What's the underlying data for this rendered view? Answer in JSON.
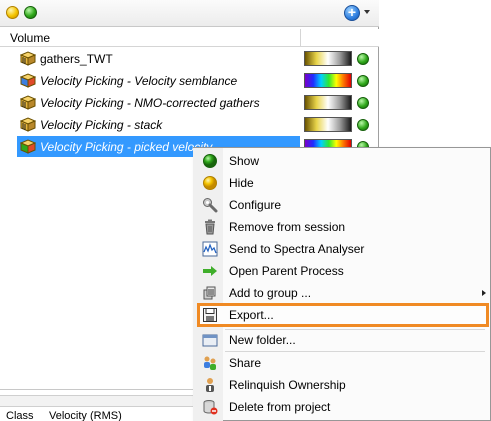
{
  "toolbar": {
    "status_dots": [
      "yellow",
      "green"
    ],
    "add_icon": "plus-circle-icon",
    "add_label": "+"
  },
  "columns": {
    "volume": "Volume"
  },
  "rows": [
    {
      "label": "gathers_TWT",
      "italic": false,
      "colorbar": "grayscale",
      "status": "green"
    },
    {
      "label": "Velocity Picking - Velocity semblance",
      "italic": true,
      "colorbar": "rainbow",
      "status": "green"
    },
    {
      "label": "Velocity Picking - NMO-corrected gathers",
      "italic": true,
      "colorbar": "grayscale",
      "status": "green"
    },
    {
      "label": "Velocity Picking - stack",
      "italic": true,
      "colorbar": "grayscale",
      "status": "green"
    },
    {
      "label": "Velocity Picking - picked velocity",
      "italic": true,
      "colorbar": "rainbow",
      "status": "green",
      "selected": true
    }
  ],
  "properties": {
    "class_label": "Class",
    "class_value": "Velocity (RMS)"
  },
  "menu": {
    "items": [
      {
        "label": "Show",
        "icon": "green-dot-icon"
      },
      {
        "label": "Hide",
        "icon": "yellow-dot-icon"
      },
      {
        "label": "Configure",
        "icon": "wrench-icon"
      },
      {
        "label": "Remove from session",
        "icon": "trash-icon"
      },
      {
        "label": "Send to Spectra Analyser",
        "icon": "spectrum-icon"
      },
      {
        "label": "Open Parent Process",
        "icon": "green-arrow-icon"
      },
      {
        "label": "Add to group ...",
        "icon": "group-icon",
        "submenu": true
      },
      {
        "label": "Export...",
        "icon": "export-icon",
        "highlighted": true
      },
      {
        "label": "New folder...",
        "icon": "folder-icon"
      },
      {
        "label": "Share",
        "icon": "share-users-icon"
      },
      {
        "label": "Relinquish Ownership",
        "icon": "relinquish-user-icon"
      },
      {
        "label": "Delete from project",
        "icon": "delete-db-icon"
      }
    ]
  },
  "colors": {
    "selection": "#3399ff",
    "highlight_border": "#f08a24",
    "status_green": "#2fa81a",
    "status_yellow": "#f4c400"
  }
}
